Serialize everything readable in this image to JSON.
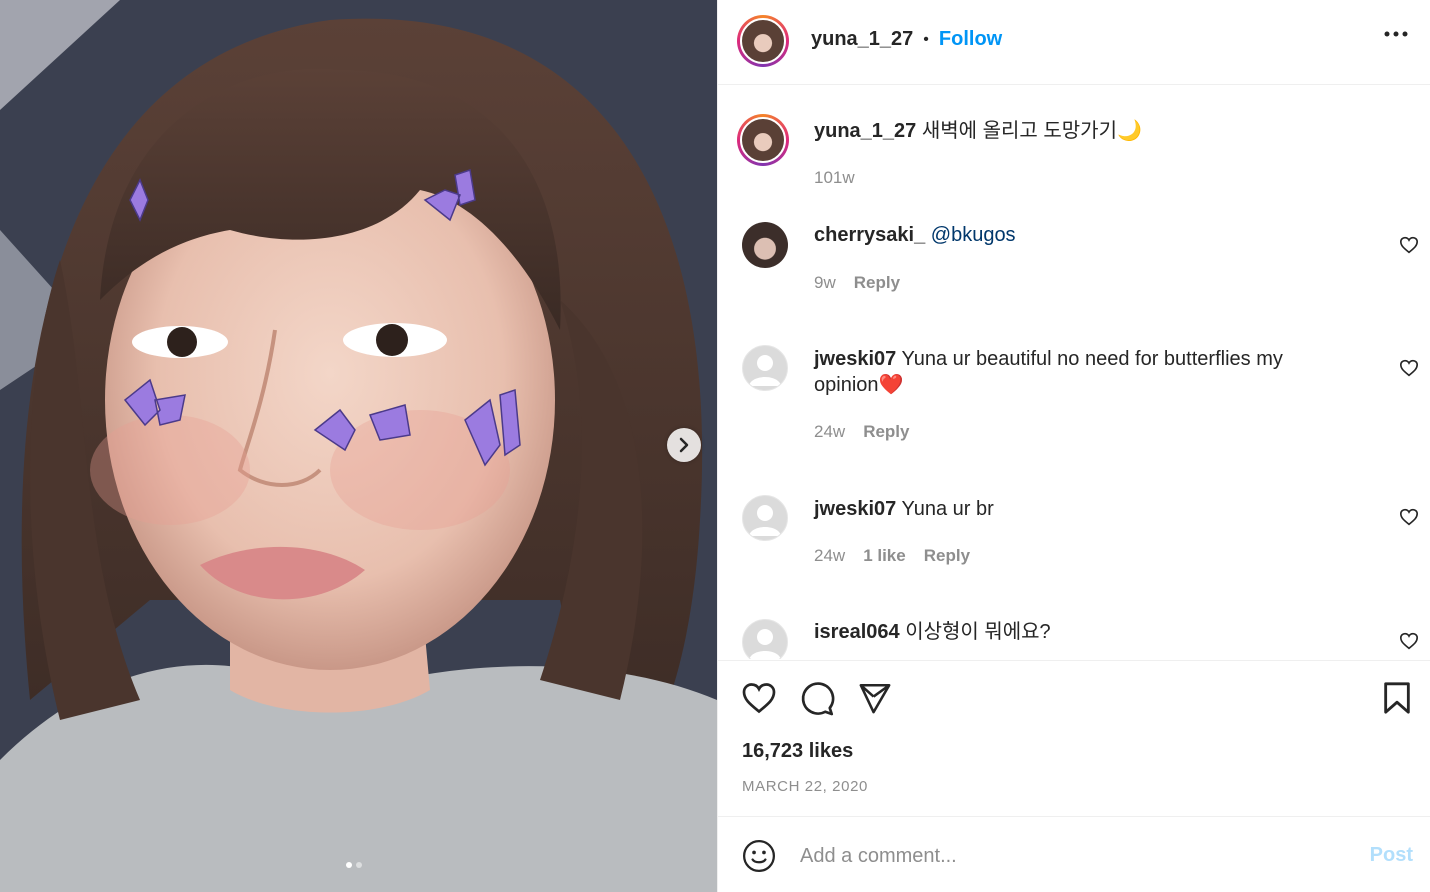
{
  "post": {
    "username": "yuna_1_27",
    "follow_label": "Follow",
    "separator": "•",
    "more_icon": "more-horizontal-icon",
    "photo_count": 2,
    "current_photo": 1
  },
  "caption": {
    "username": "yuna_1_27",
    "text": "새벽에 올리고 도망가기🌙",
    "time": "101w"
  },
  "comments": [
    {
      "username": "cherrysaki_",
      "text": "",
      "mention": "@bkugos",
      "time": "9w",
      "likes": "",
      "reply": "Reply",
      "avatar": "photo"
    },
    {
      "username": "jweski07",
      "text": "Yuna ur beautiful no need for butterflies my opinion❤️",
      "mention": "",
      "time": "24w",
      "likes": "",
      "reply": "Reply",
      "avatar": "default"
    },
    {
      "username": "jweski07",
      "text": "Yuna ur br",
      "mention": "",
      "time": "24w",
      "likes": "1 like",
      "reply": "Reply",
      "avatar": "default"
    },
    {
      "username": "isreal064",
      "text": "이상형이 뭐에요?",
      "mention": "",
      "time": "",
      "likes": "",
      "reply": "",
      "avatar": "default"
    }
  ],
  "actions": {
    "likes": "16,723 likes",
    "date": "MARCH 22, 2020"
  },
  "composer": {
    "placeholder": "Add a comment...",
    "post_label": "Post"
  },
  "colors": {
    "link_blue": "#0095f6",
    "muted": "#8e8e8e",
    "post_disabled": "#b2dffc",
    "butterfly": "#9b7be0"
  }
}
